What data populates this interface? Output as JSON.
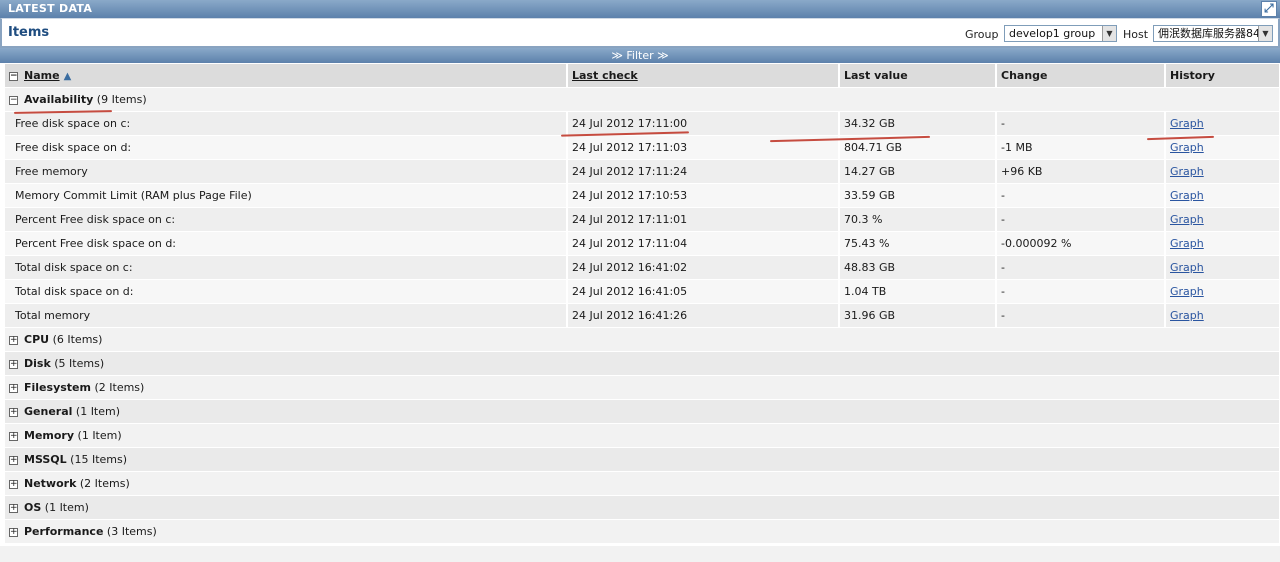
{
  "window": {
    "title": "LATEST DATA"
  },
  "header": {
    "title": "Items",
    "group_label": "Group",
    "group_value": "develop1 group",
    "host_label": "Host",
    "host_value": "佣泯数据库服务器84"
  },
  "filter": {
    "label": "≫ Filter ≫"
  },
  "columns": {
    "name": "Name",
    "last_check": "Last check",
    "last_value": "Last value",
    "change": "Change",
    "history": "History"
  },
  "availability": {
    "name": "Availability",
    "count": "(9 Items)",
    "items": [
      {
        "name": "Free disk space on c:",
        "last_check": "24 Jul 2012 17:11:00",
        "last_value": "34.32 GB",
        "change": "-",
        "history": "Graph"
      },
      {
        "name": "Free disk space on d:",
        "last_check": "24 Jul 2012 17:11:03",
        "last_value": "804.71 GB",
        "change": "-1 MB",
        "history": "Graph"
      },
      {
        "name": "Free memory",
        "last_check": "24 Jul 2012 17:11:24",
        "last_value": "14.27 GB",
        "change": "+96 KB",
        "history": "Graph"
      },
      {
        "name": "Memory Commit Limit (RAM plus Page File)",
        "last_check": "24 Jul 2012 17:10:53",
        "last_value": "33.59 GB",
        "change": "-",
        "history": "Graph"
      },
      {
        "name": "Percent Free disk space on c:",
        "last_check": "24 Jul 2012 17:11:01",
        "last_value": "70.3 %",
        "change": "-",
        "history": "Graph"
      },
      {
        "name": "Percent Free disk space on d:",
        "last_check": "24 Jul 2012 17:11:04",
        "last_value": "75.43 %",
        "change": "-0.000092 %",
        "history": "Graph"
      },
      {
        "name": "Total disk space on c:",
        "last_check": "24 Jul 2012 16:41:02",
        "last_value": "48.83 GB",
        "change": "-",
        "history": "Graph"
      },
      {
        "name": "Total disk space on d:",
        "last_check": "24 Jul 2012 16:41:05",
        "last_value": "1.04 TB",
        "change": "-",
        "history": "Graph"
      },
      {
        "name": "Total memory",
        "last_check": "24 Jul 2012 16:41:26",
        "last_value": "31.96 GB",
        "change": "-",
        "history": "Graph"
      }
    ]
  },
  "groups": [
    {
      "name": "CPU",
      "count": "(6 Items)"
    },
    {
      "name": "Disk",
      "count": "(5 Items)"
    },
    {
      "name": "Filesystem",
      "count": "(2 Items)"
    },
    {
      "name": "General",
      "count": "(1 Item)"
    },
    {
      "name": "Memory",
      "count": "(1 Item)"
    },
    {
      "name": "MSSQL",
      "count": "(15 Items)"
    },
    {
      "name": "Network",
      "count": "(2 Items)"
    },
    {
      "name": "OS",
      "count": "(1 Item)"
    },
    {
      "name": "Performance",
      "count": "(3 Items)"
    }
  ],
  "icons": {
    "collapse": "minus-box-icon",
    "expand": "plus-box-icon",
    "sort": "sort-up-arrow-icon",
    "fullscreen": "fullscreen-icon"
  },
  "colors": {
    "accent": "#5c81ab",
    "link": "#2a55a0",
    "annotation": "#c0392b"
  }
}
